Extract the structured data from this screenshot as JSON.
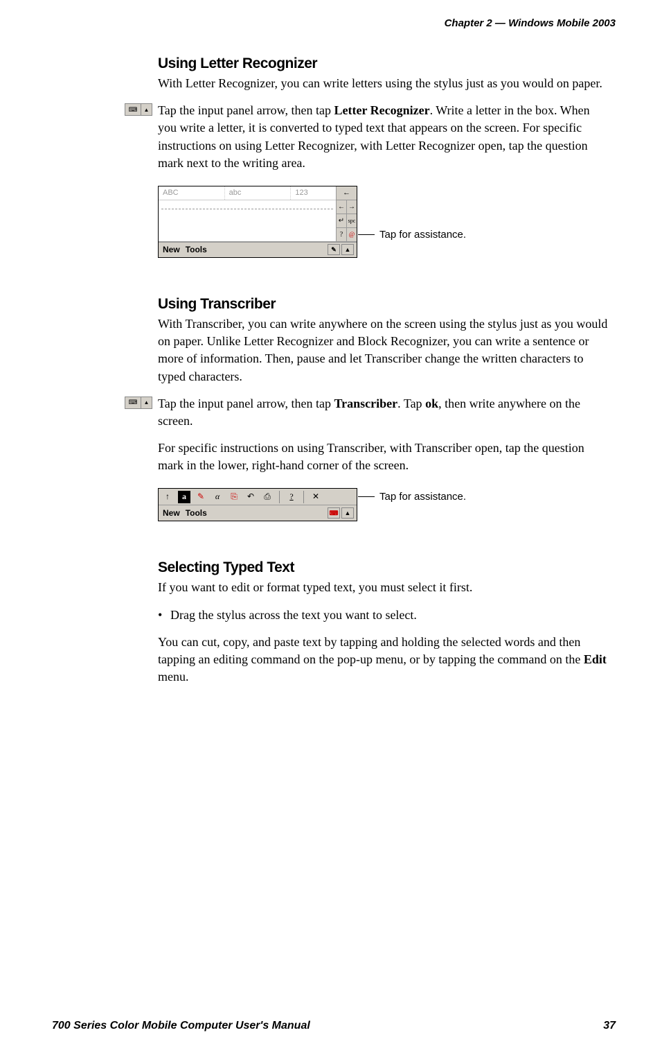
{
  "header": {
    "text": "Chapter  2  —    Windows Mobile 2003"
  },
  "section1": {
    "heading": "Using Letter Recognizer",
    "intro": "With Letter Recognizer, you can write letters using the stylus just as you would on paper.",
    "instruction_pre": "Tap the input panel arrow, then tap ",
    "instruction_bold": "Letter Recognizer",
    "instruction_post": ". Write a letter in the box. When you write a letter, it is converted to typed text that appears on the screen. For specific instructions on using Letter Recognizer, with Letter Recognizer open, tap the question mark next to the writing area.",
    "figure": {
      "tabs": [
        "ABC",
        "abc",
        "123"
      ],
      "side_back": "←",
      "side_fwd_l": "←",
      "side_fwd_r": "→",
      "side_spc": "spc",
      "side_q": "?",
      "side_at": "@",
      "footer_new": "New",
      "footer_tools": "Tools",
      "pencil": "✎",
      "up": "▲",
      "callout": "Tap for assistance."
    }
  },
  "section2": {
    "heading": "Using Transcriber",
    "intro": "With Transcriber, you can write anywhere on the screen using the stylus just as you would on paper. Unlike Letter Recognizer and Block Recognizer, you can write a sentence or more of information. Then, pause and let Transcriber change the written characters to typed characters.",
    "instruction_pre": "Tap the input panel arrow, then tap ",
    "instruction_bold1": "Transcriber",
    "instruction_mid": ". Tap ",
    "instruction_bold2": "ok",
    "instruction_post": ", then write anywhere on the screen.",
    "para3": "For specific instructions on using Transcriber, with Transcriber open, tap the question mark in the lower, right-hand corner of the screen.",
    "figure": {
      "icons": {
        "up": "↑",
        "a": "a",
        "pen": "✎",
        "alpha": "α",
        "book": "⎘",
        "undo": "↶",
        "copy": "⎙",
        "help": "?",
        "close": "✕"
      },
      "footer_new": "New",
      "footer_tools": "Tools",
      "kbd": "⌨",
      "arrow": "▲",
      "callout": "Tap for assistance."
    }
  },
  "section3": {
    "heading": "Selecting Typed Text",
    "intro": "If you want to edit or format typed text, you must select it first.",
    "bullet": "Drag the stylus across the text you want to select.",
    "para_pre": "You can cut, copy, and paste text by tapping and holding the selected words and then tapping an editing command on the pop-up menu, or by tapping the command on the ",
    "para_bold": "Edit",
    "para_post": " menu."
  },
  "footer": {
    "title": "700 Series Color Mobile Computer User's Manual",
    "page": "37"
  }
}
